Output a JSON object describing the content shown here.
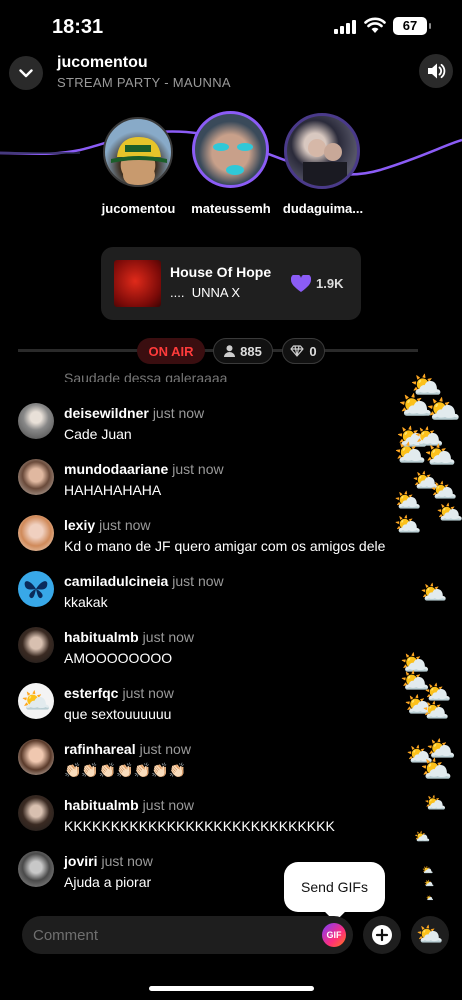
{
  "status": {
    "time": "18:31",
    "battery": "67"
  },
  "header": {
    "host": "jucomentou",
    "subtitle": "STREAM PARTY - MAUNNA"
  },
  "party": {
    "members": [
      {
        "name": "jucomentou"
      },
      {
        "name": "mateussemh"
      },
      {
        "name": "dudaguima..."
      }
    ]
  },
  "song": {
    "title": "House Of Hope",
    "artist": "UNNA X",
    "artist_prefix": "....",
    "likes": "1.9K"
  },
  "live": {
    "on_air": "ON AIR",
    "viewers": "885",
    "gems": "0"
  },
  "chat": {
    "cut_text": "Saudade dessa galeraaaa",
    "messages": [
      {
        "user": "deisewildner",
        "time": "just now",
        "text": "Cade Juan"
      },
      {
        "user": "mundodaariane",
        "time": "just now",
        "text": "HAHAHAHAHA"
      },
      {
        "user": "lexiy",
        "time": "just now",
        "text": "Kd o mano de JF quero amigar com os amigos dele"
      },
      {
        "user": "camiladulcineia",
        "time": "just now",
        "text": "kkakak"
      },
      {
        "user": "habitualmb",
        "time": "just now",
        "text": "AMOOOOOOOO"
      },
      {
        "user": "esterfqc",
        "time": "just now",
        "text": "que sextouuuuuu"
      },
      {
        "user": "rafinhareal",
        "time": "just now",
        "text": "👏🏻👏🏻👏🏻👏🏻👏🏻👏🏻👏🏻"
      },
      {
        "user": "habitualmb",
        "time": "just now",
        "text": "KKKKKKKKKKKKKKKKKKKKKKKKKKKKK"
      },
      {
        "user": "joviri",
        "time": "just now",
        "text": "Ajuda a piorar"
      }
    ]
  },
  "tooltip": {
    "text": "Send GIFs"
  },
  "composer": {
    "placeholder": "Comment",
    "gif_label": "GIF"
  },
  "colors": {
    "accent": "#8b5cf6",
    "on_air": "#ff3b3b",
    "background": "#000000"
  }
}
